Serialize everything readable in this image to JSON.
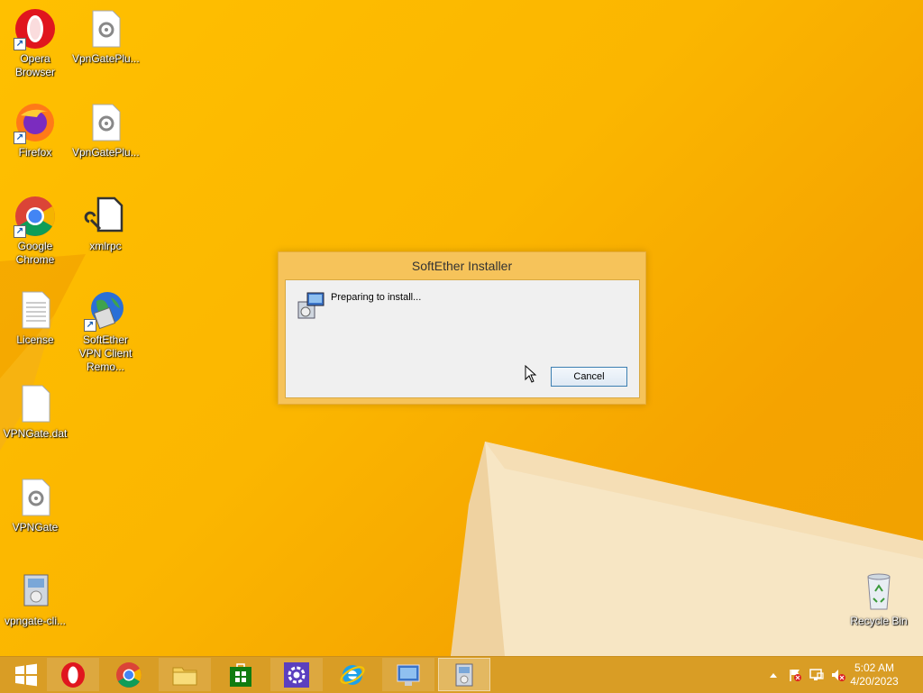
{
  "desktop": {
    "icons": [
      {
        "label": "Opera Browser",
        "icon": "opera-icon"
      },
      {
        "label": "VpnGatePlu...",
        "icon": "settings-file-icon"
      },
      {
        "label": "Firefox",
        "icon": "firefox-icon"
      },
      {
        "label": "VpnGatePlu...",
        "icon": "settings-file-icon"
      },
      {
        "label": "Google Chrome",
        "icon": "chrome-icon"
      },
      {
        "label": "xmlrpc",
        "icon": "wrench-file-icon"
      },
      {
        "label": "License",
        "icon": "text-file-icon"
      },
      {
        "label": "SoftEther VPN Client Remo...",
        "icon": "vpn-globe-icon"
      },
      {
        "label": "VPNGate.dat",
        "icon": "blank-file-icon"
      },
      {
        "label": "VPNGate",
        "icon": "settings-file-icon"
      },
      {
        "label": "vpngate-cli...",
        "icon": "installer-icon"
      },
      {
        "label": "Recycle Bin",
        "icon": "recycle-bin-icon"
      }
    ]
  },
  "dialog": {
    "title": "SoftEther Installer",
    "message": "Preparing to install...",
    "cancel_label": "Cancel"
  },
  "taskbar": {
    "items": [
      {
        "name": "start",
        "icon": "windows-logo-icon"
      },
      {
        "name": "opera",
        "icon": "opera-icon"
      },
      {
        "name": "chrome",
        "icon": "chrome-icon"
      },
      {
        "name": "file-explorer",
        "icon": "folder-icon"
      },
      {
        "name": "store",
        "icon": "store-icon"
      },
      {
        "name": "settings",
        "icon": "gear-icon"
      },
      {
        "name": "internet-explorer",
        "icon": "ie-icon"
      },
      {
        "name": "control-panel",
        "icon": "control-panel-icon"
      },
      {
        "name": "installer",
        "icon": "installer-icon"
      }
    ],
    "tray": [
      "chevron-up-icon",
      "flag-icon",
      "network-icon",
      "volume-muted-icon"
    ],
    "clock": {
      "time": "5:02 AM",
      "date": "4/20/2023"
    }
  },
  "colors": {
    "desktop_yellow": "#f9b400",
    "accent_orange": "#f0a200",
    "dialog_frame": "#f6c35a"
  }
}
